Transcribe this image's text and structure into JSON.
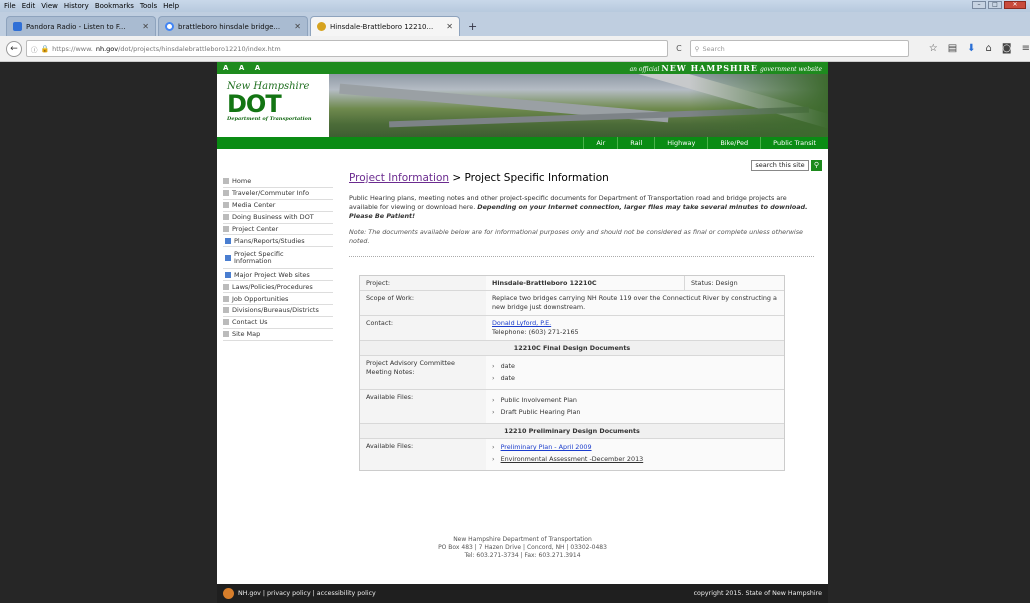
{
  "menubar": {
    "items": [
      "File",
      "Edit",
      "View",
      "History",
      "Bookmarks",
      "Tools",
      "Help"
    ]
  },
  "tabs": [
    {
      "label": "Pandora Radio - Listen to F...",
      "color": "#2f6fd6"
    },
    {
      "label": "brattleboro hinsdale bridge...",
      "color": "#4285f4"
    },
    {
      "label": "Hinsdale-Brattleboro 12210...",
      "color": "#d6a31f"
    }
  ],
  "nav": {
    "url_prefix": "https://www.",
    "url_domain": "nh.gov",
    "url_path": "/dot/projects/hinsdalebrattleboro12210/index.htm",
    "search_placeholder": "Search"
  },
  "site": {
    "text_size": "A A A",
    "official_prefix": "an official",
    "official_name": "NEW HAMPSHIRE",
    "official_suffix": "government website",
    "logo_script": "New Hampshire",
    "logo_dot": "DOT",
    "logo_dept": "Department of Transportation",
    "topnav": [
      "Air",
      "Rail",
      "Highway",
      "Bike/Ped",
      "Public Transit"
    ],
    "search_label": "search this site"
  },
  "sidebar": [
    {
      "label": "Home"
    },
    {
      "label": "Traveler/Commuter Info"
    },
    {
      "label": "Media Center"
    },
    {
      "label": "Doing Business with DOT"
    },
    {
      "label": "Project Center"
    },
    {
      "label": "Plans/Reports/Studies"
    },
    {
      "label": "Project Specific Information"
    },
    {
      "label": "Major Project Web sites"
    },
    {
      "label": "Laws/Policies/Procedures"
    },
    {
      "label": "Job Opportunities"
    },
    {
      "label": "Divisions/Bureaus/Districts"
    },
    {
      "label": "Contact Us"
    },
    {
      "label": "Site Map"
    }
  ],
  "main": {
    "breadcrumb_link": "Project Information",
    "breadcrumb_rest": " > Project Specific Information",
    "intro_text": "Public Hearing plans, meeting notes and other project-specific documents for Department of Transportation road and bridge projects are available for viewing or download here. ",
    "intro_bold": "Depending on your Internet connection, larger files may take several minutes to download. Please Be Patient!",
    "note": "Note: The documents available below are for informational purposes only and should not be considered as final or complete unless otherwise noted."
  },
  "project": {
    "project_label": "Project:",
    "project_name": "Hinsdale-Brattleboro 12210C",
    "status": "Status: Design",
    "scope_label": "Scope of Work:",
    "scope": "Replace two bridges carrying NH Route 119 over the Connecticut River by constructing a new bridge just downstream.",
    "contact_label": "Contact:",
    "contact_name": "Donald Lyford, P.E.",
    "contact_phone": "Telephone: (603) 271-2165",
    "final_header": "12210C Final Design Documents",
    "pac_label": "Project Advisory Committee Meeting Notes:",
    "pac_items": [
      "date",
      "date"
    ],
    "files_label": "Available Files:",
    "final_files": [
      "Public Involvement Plan",
      "Draft Public Hearing Plan"
    ],
    "prelim_header": "12210 Preliminary Design Documents",
    "prelim_files": [
      "Preliminary Plan - April 2009",
      "Environmental Assessment -December 2013"
    ]
  },
  "footer": {
    "line1": "New Hampshire Department of Transportation",
    "line2": "PO Box 483 | 7 Hazen Drive | Concord, NH | 03302-0483",
    "line3": "Tel: 603.271-3734 | Fax: 603.271.3914"
  },
  "bottom": {
    "left": "NH.gov | privacy policy | accessibility policy",
    "right": "copyright 2015. State of New Hampshire"
  }
}
